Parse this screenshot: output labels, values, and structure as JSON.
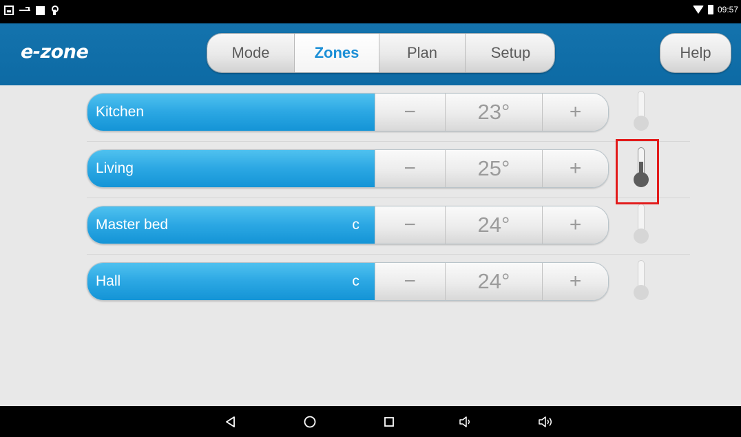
{
  "status_bar": {
    "time": "09:57",
    "left_icons": [
      "gallery-icon",
      "usb-icon",
      "square-icon",
      "touch-icon"
    ],
    "right_icons": [
      "wifi-icon",
      "battery-icon"
    ]
  },
  "header": {
    "logo": "e-zone",
    "tabs": [
      {
        "label": "Mode",
        "active": false
      },
      {
        "label": "Zones",
        "active": true
      },
      {
        "label": "Plan",
        "active": false
      },
      {
        "label": "Setup",
        "active": false
      }
    ],
    "help_label": "Help"
  },
  "zones": [
    {
      "name": "Kitchen",
      "mode": "",
      "minus": "−",
      "temperature": "23°",
      "plus": "+",
      "sensor_active": false
    },
    {
      "name": "Living",
      "mode": "",
      "minus": "−",
      "temperature": "25°",
      "plus": "+",
      "sensor_active": true
    },
    {
      "name": "Master bed",
      "mode": "c",
      "minus": "−",
      "temperature": "24°",
      "plus": "+",
      "sensor_active": false
    },
    {
      "name": "Hall",
      "mode": "c",
      "minus": "−",
      "temperature": "24°",
      "plus": "+",
      "sensor_active": false
    }
  ],
  "nav_bar": {
    "buttons": [
      "back-icon",
      "home-icon",
      "recent-apps-icon",
      "volume-down-icon",
      "volume-up-icon"
    ]
  },
  "colors": {
    "header_blue": "#1473ad",
    "zone_blue": "#2ba7e3",
    "active_tab_text": "#1b8fd6",
    "highlight_red": "#e21b1b"
  }
}
